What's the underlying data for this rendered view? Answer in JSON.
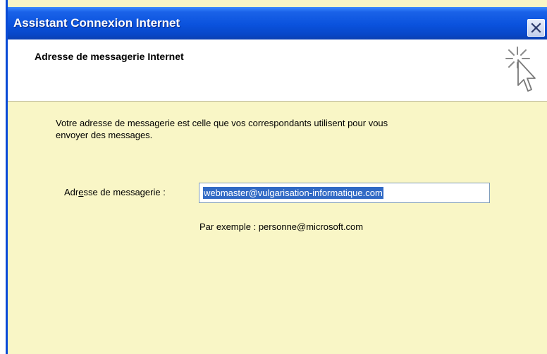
{
  "window": {
    "title": "Assistant Connexion Internet",
    "accent": "#0a52dd",
    "body_color": "#f9f6c6"
  },
  "header": {
    "title": "Adresse de messagerie Internet",
    "icon": "wizard-wand-icon"
  },
  "content": {
    "intro_line1": "Votre adresse de messagerie est celle que vos correspondants utilisent pour vous",
    "intro_line2": "envoyer des messages.",
    "email_label_pre": "Adr",
    "email_label_accel": "e",
    "email_label_post": "sse de messagerie :",
    "email_value": "webmaster@vulgarisation-informatique.com",
    "example": "Par exemple : personne@microsoft.com"
  }
}
